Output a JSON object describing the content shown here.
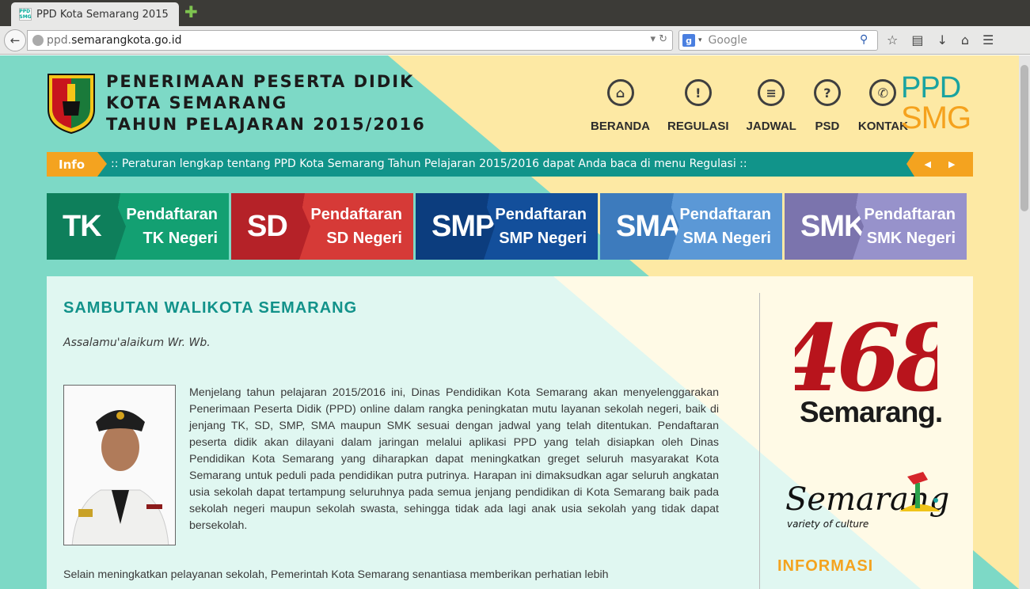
{
  "browser": {
    "tab_title": "PPD Kota Semarang 2015",
    "favicon_text": "PPD SMG",
    "new_tab": "✚",
    "url_host": "ppd.",
    "url_domain": "semarangkota.go.id",
    "search_placeholder": "Google",
    "search_engine_letter": "g"
  },
  "header": {
    "title_line1": "PENERIMAAN PESERTA DIDIK",
    "title_line2": "KOTA SEMARANG",
    "title_line3": "TAHUN PELAJARAN 2015/2016",
    "menu": [
      {
        "label": "BERANDA",
        "icon": "home-icon",
        "glyph": "⌂"
      },
      {
        "label": "REGULASI",
        "icon": "exclamation-icon",
        "glyph": "!"
      },
      {
        "label": "JADWAL",
        "icon": "list-icon",
        "glyph": "≡"
      },
      {
        "label": "PSD",
        "icon": "question-icon",
        "glyph": "?"
      },
      {
        "label": "KONTAK",
        "icon": "phone-icon",
        "glyph": "✆"
      }
    ],
    "ppd_logo_top": "PPD",
    "ppd_logo_bottom": "SMG"
  },
  "ticker": {
    "label": "Info",
    "text": ":: Peraturan lengkap tentang PPD Kota Semarang Tahun Pelajaran 2015/2016 dapat Anda baca di menu Regulasi ::",
    "prev": "◀",
    "next": "▶"
  },
  "levels": [
    {
      "abbr": "TK",
      "line1": "Pendaftaran",
      "line2": "TK Negeri",
      "color": "#0e7f5b",
      "color2": "#13a072"
    },
    {
      "abbr": "SD",
      "line1": "Pendaftaran",
      "line2": "SD Negeri",
      "color": "#b52228",
      "color2": "#d63a37"
    },
    {
      "abbr": "SMP",
      "line1": "Pendaftaran",
      "line2": "SMP Negeri",
      "color": "#0c3d7e",
      "color2": "#134f9b"
    },
    {
      "abbr": "SMA",
      "line1": "Pendaftaran",
      "line2": "SMA Negeri",
      "color": "#3d7bbd",
      "color2": "#5b98d6"
    },
    {
      "abbr": "SMK",
      "line1": "Pendaftaran",
      "line2": "SMK Negeri",
      "color": "#7b74ad",
      "color2": "#9792cb"
    }
  ],
  "main": {
    "section_title": "SAMBUTAN WALIKOTA SEMARANG",
    "greeting": "Assalamu'alaikum Wr. Wb.",
    "paragraph1": "Menjelang tahun pelajaran 2015/2016 ini, Dinas Pendidikan Kota Semarang akan menyelenggarakan Penerimaan Peserta Didik (PPD) online dalam rangka peningkatan mutu layanan sekolah negeri, baik di jenjang TK, SD, SMP, SMA maupun SMK sesuai dengan jadwal yang telah ditentukan. Pendaftaran peserta didik akan dilayani dalam jaringan melalui aplikasi PPD yang telah disiapkan oleh Dinas Pendidikan Kota Semarang yang diharapkan dapat meningkatkan greget seluruh masyarakat Kota Semarang untuk peduli pada pendidikan putra putrinya. Harapan ini dimaksudkan agar seluruh angkatan usia sekolah dapat tertampung seluruhnya pada semua jenjang pendidikan di Kota Semarang baik pada sekolah negeri maupun sekolah swasta, sehingga tidak ada lagi anak usia sekolah yang tidak dapat bersekolah.",
    "paragraph2": "Selain meningkatkan pelayanan sekolah, Pemerintah Kota Semarang senantiasa memberikan perhatian lebih"
  },
  "sidebar": {
    "logo_468": "468",
    "logo_468_caption": "Semarang.",
    "logo_variety_word": "Semarang",
    "logo_variety_tagline": "variety of culture",
    "info_heading": "INFORMASI"
  },
  "colors": {
    "teal": "#12928a",
    "orange": "#f4a31f",
    "bg_teal": "#7dd9c6",
    "bg_yellow": "#fde9a4",
    "red_468": "#b8141c"
  }
}
